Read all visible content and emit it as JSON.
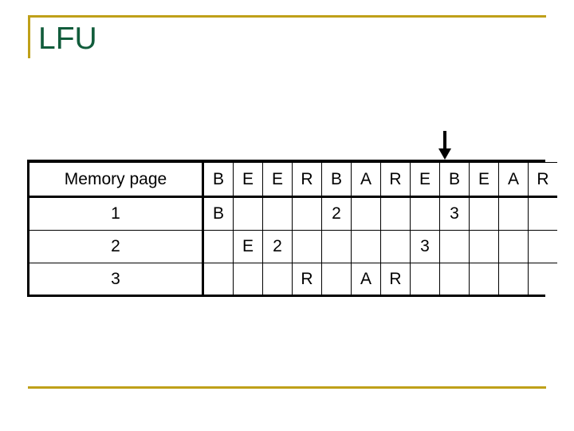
{
  "slide": {
    "title": "LFU",
    "accent_color": "#bfa019",
    "title_color": "#115c3b",
    "background": "#ffffff"
  },
  "annotations": {
    "pointer": {
      "icon": "down-arrow-icon",
      "points_at_column_index": 9,
      "points_at_column_label": "B"
    }
  },
  "table": {
    "row_header_label": "Memory page",
    "reference_string": [
      "B",
      "E",
      "E",
      "R",
      "B",
      "A",
      "R",
      "E",
      "B",
      "E",
      "A",
      "R"
    ],
    "reference_color": "#cc7fe0",
    "count_color": "#b01722",
    "rows": [
      {
        "label": "1",
        "cells": [
          {
            "text": "B",
            "kind": "ref"
          },
          {
            "text": "",
            "kind": "empty"
          },
          {
            "text": "",
            "kind": "empty"
          },
          {
            "text": "",
            "kind": "empty"
          },
          {
            "text": "2",
            "kind": "count"
          },
          {
            "text": "",
            "kind": "empty"
          },
          {
            "text": "",
            "kind": "empty"
          },
          {
            "text": "",
            "kind": "empty"
          },
          {
            "text": "3",
            "kind": "count"
          },
          {
            "text": "",
            "kind": "empty"
          },
          {
            "text": "",
            "kind": "empty"
          },
          {
            "text": "",
            "kind": "empty"
          }
        ]
      },
      {
        "label": "2",
        "cells": [
          {
            "text": "",
            "kind": "empty"
          },
          {
            "text": "E",
            "kind": "ref"
          },
          {
            "text": "2",
            "kind": "count"
          },
          {
            "text": "",
            "kind": "empty"
          },
          {
            "text": "",
            "kind": "empty"
          },
          {
            "text": "",
            "kind": "empty"
          },
          {
            "text": "",
            "kind": "empty"
          },
          {
            "text": "3",
            "kind": "count"
          },
          {
            "text": "",
            "kind": "empty"
          },
          {
            "text": "",
            "kind": "empty"
          },
          {
            "text": "",
            "kind": "empty"
          },
          {
            "text": "",
            "kind": "empty"
          }
        ]
      },
      {
        "label": "3",
        "cells": [
          {
            "text": "",
            "kind": "empty"
          },
          {
            "text": "",
            "kind": "empty"
          },
          {
            "text": "",
            "kind": "empty"
          },
          {
            "text": "R",
            "kind": "ref"
          },
          {
            "text": "",
            "kind": "empty"
          },
          {
            "text": "A",
            "kind": "ref"
          },
          {
            "text": "R",
            "kind": "ref"
          },
          {
            "text": "",
            "kind": "empty"
          },
          {
            "text": "",
            "kind": "empty"
          },
          {
            "text": "",
            "kind": "empty"
          },
          {
            "text": "",
            "kind": "empty"
          },
          {
            "text": "",
            "kind": "empty"
          }
        ]
      }
    ]
  }
}
